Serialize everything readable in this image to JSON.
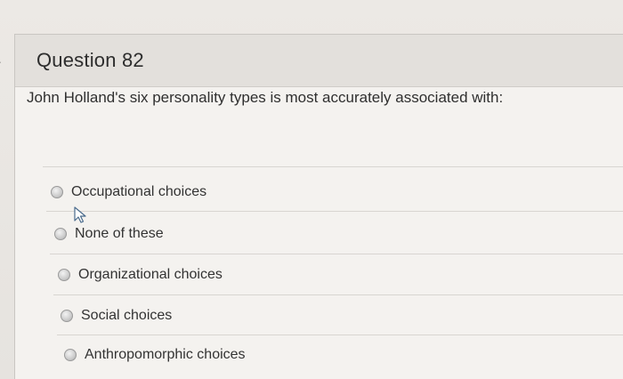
{
  "question": {
    "title": "Question 82",
    "text": "John Holland's six personality types is most accurately associated with:",
    "options": [
      {
        "label": "Occupational choices",
        "selected": false
      },
      {
        "label": "None of these",
        "selected": false
      },
      {
        "label": "Organizational choices",
        "selected": false
      },
      {
        "label": "Social choices",
        "selected": false
      },
      {
        "label": "Anthropomorphic choices",
        "selected": false
      }
    ]
  },
  "icons": {
    "nav": "chevron-right-icon",
    "cursor": "mouse-pointer-icon",
    "radio": "radio-button-icon"
  },
  "colors": {
    "card_background": "#f4f2ef",
    "header_background": "#e3e0dc",
    "text": "#2f2f2f"
  }
}
